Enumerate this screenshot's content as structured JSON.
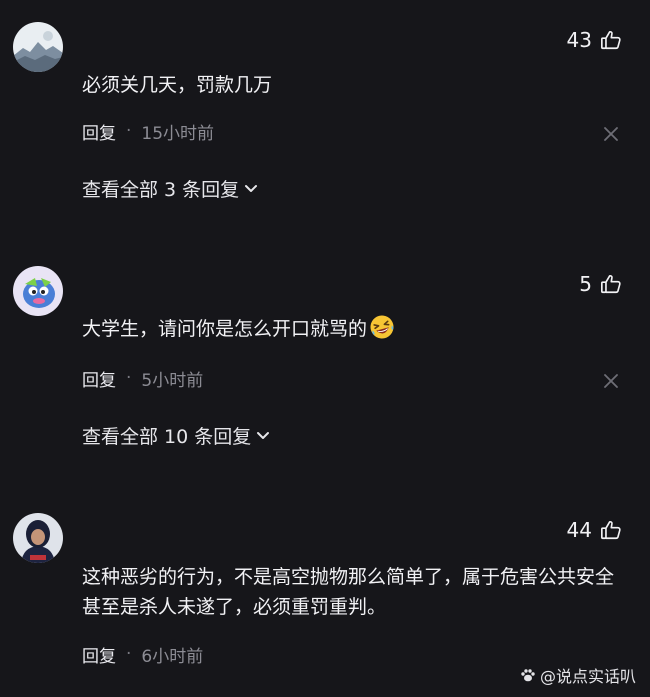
{
  "comments": [
    {
      "likes": "43",
      "text": "必须关几天，罚款几万",
      "reply_label": "回复",
      "separator": "·",
      "time": "15小时前",
      "view_all": "查看全部 3 条回复"
    },
    {
      "likes": "5",
      "text": "大学生，请问你是怎么开口就骂的",
      "reply_label": "回复",
      "separator": "·",
      "time": "5小时前",
      "view_all": "查看全部 10 条回复"
    },
    {
      "likes": "44",
      "text": "这种恶劣的行为，不是高空抛物那么简单了，属于危害公共安全甚至是杀人未遂了，必须重罚重判。",
      "reply_label": "回复",
      "separator": "·",
      "time": "6小时前"
    }
  ],
  "watermark": "@说点实话叭",
  "colors": {
    "background": "#16161a",
    "text": "#f2f2f5",
    "muted": "#8c8c94"
  },
  "icons": [
    "thumbs-up-icon",
    "close-icon",
    "chevron-down-icon",
    "grinning-squint-emoji-icon",
    "paw-icon"
  ]
}
